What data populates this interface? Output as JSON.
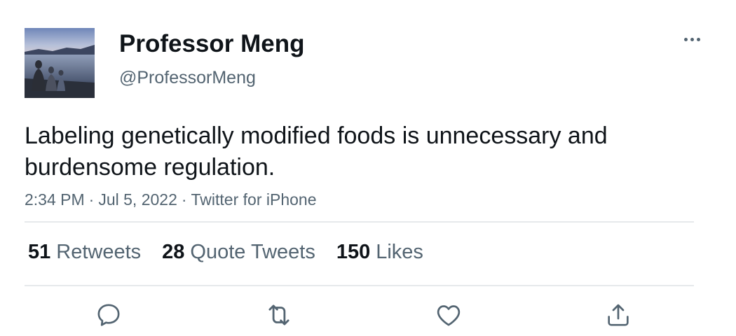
{
  "author": {
    "display_name": "Professor Meng",
    "handle": "@ProfessorMeng",
    "avatar": "profile photo of people sitting by a lake at dusk"
  },
  "more_icon": "more-horizontal-icon",
  "tweet": {
    "text": "Labeling genetically modified foods is unnecessary and burdensome regulation.",
    "time": "2:34 PM",
    "date": "Jul 5, 2022",
    "source": "Twitter for iPhone",
    "separator": "·"
  },
  "stats": {
    "retweets": {
      "count": "51",
      "label": "Retweets"
    },
    "quote_tweets": {
      "count": "28",
      "label": "Quote Tweets"
    },
    "likes": {
      "count": "150",
      "label": "Likes"
    }
  },
  "actions": [
    "reply-icon",
    "retweet-icon",
    "like-icon",
    "share-icon"
  ],
  "colors": {
    "text_primary": "#0f1419",
    "text_secondary": "#536471",
    "divider": "#e6e9eb",
    "icon": "#536471"
  }
}
